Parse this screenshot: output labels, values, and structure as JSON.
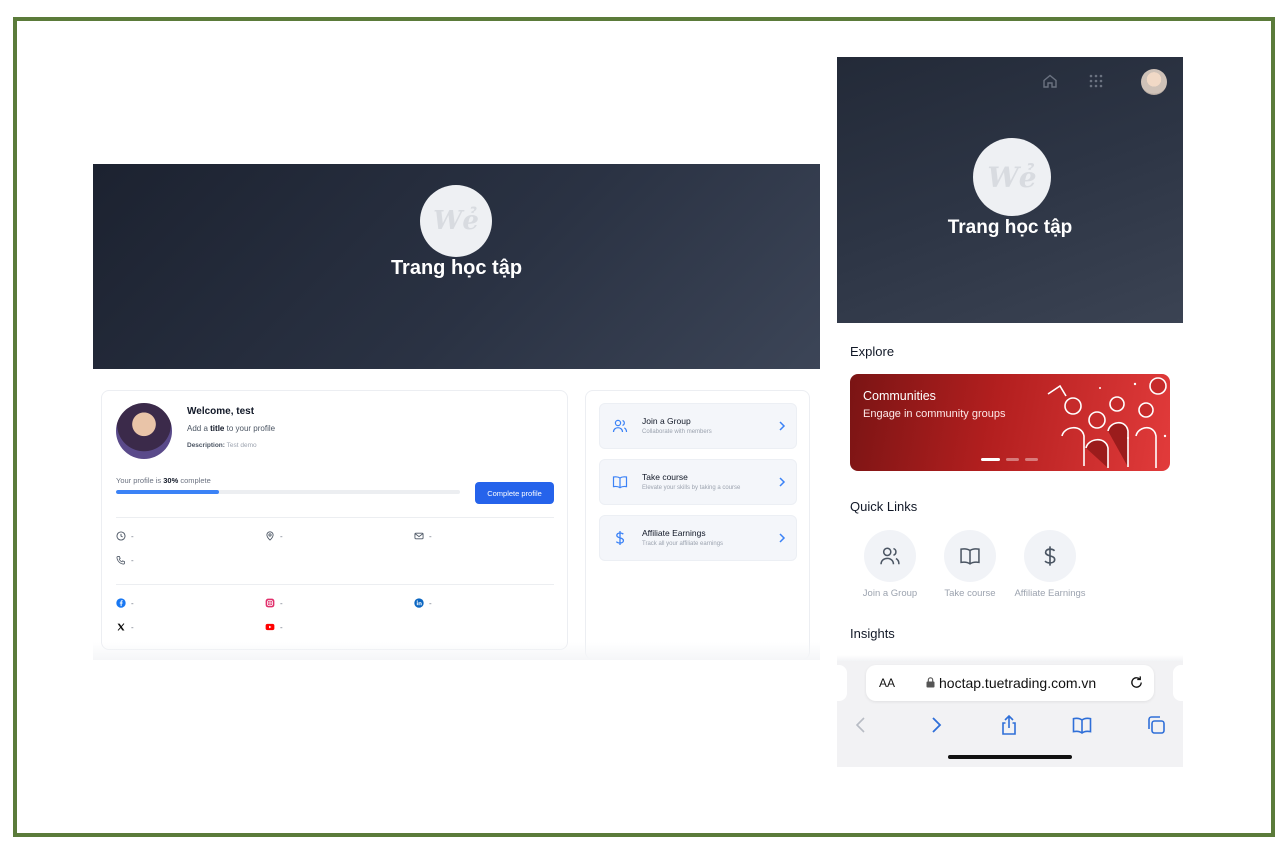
{
  "desktop": {
    "banner": {
      "logo_text": "Wẻ",
      "title": "Trang học tập"
    },
    "profile": {
      "welcome": "Welcome, test",
      "add_title_prefix": "Add a ",
      "add_title_bold": "title",
      "add_title_suffix": " to your profile",
      "description_label": "Description:",
      "description_value": "Test demo",
      "progress_prefix": "Your profile is ",
      "progress_value": "30%",
      "progress_suffix": " complete",
      "progress_fraction": 0.3,
      "complete_button": "Complete profile",
      "info": {
        "time": "-",
        "location": "-",
        "email": "-",
        "phone": "-"
      },
      "social": {
        "facebook": "-",
        "instagram": "-",
        "linkedin": "-",
        "x": "-",
        "youtube": "-"
      }
    },
    "actions": [
      {
        "title": "Join a Group",
        "subtitle": "Collaborate with members",
        "icon": "users-icon"
      },
      {
        "title": "Take course",
        "subtitle": "Elevate your skills by taking a course",
        "icon": "book-icon"
      },
      {
        "title": "Affiliate Earnings",
        "subtitle": "Track all your affiliate earnings",
        "icon": "dollar-icon"
      }
    ]
  },
  "mobile": {
    "banner": {
      "logo_text": "Wẻ",
      "title": "Trang học tập"
    },
    "explore_heading": "Explore",
    "hero": {
      "title": "Communities",
      "subtitle": "Engage in community groups"
    },
    "quick_links_heading": "Quick Links",
    "quick_links": [
      {
        "label": "Join a Group",
        "icon": "users-icon"
      },
      {
        "label": "Take course",
        "icon": "book-icon"
      },
      {
        "label": "Affiliate Earnings",
        "icon": "dollar-icon"
      }
    ],
    "insights_heading": "Insights",
    "browser": {
      "text_size": "AA",
      "url": "hoctap.tuetrading.com.vn"
    }
  },
  "colors": {
    "accent": "#2563eb",
    "banner": "#2a3243",
    "hero_red": "#b31f1f",
    "frame": "#5b7b3a"
  }
}
